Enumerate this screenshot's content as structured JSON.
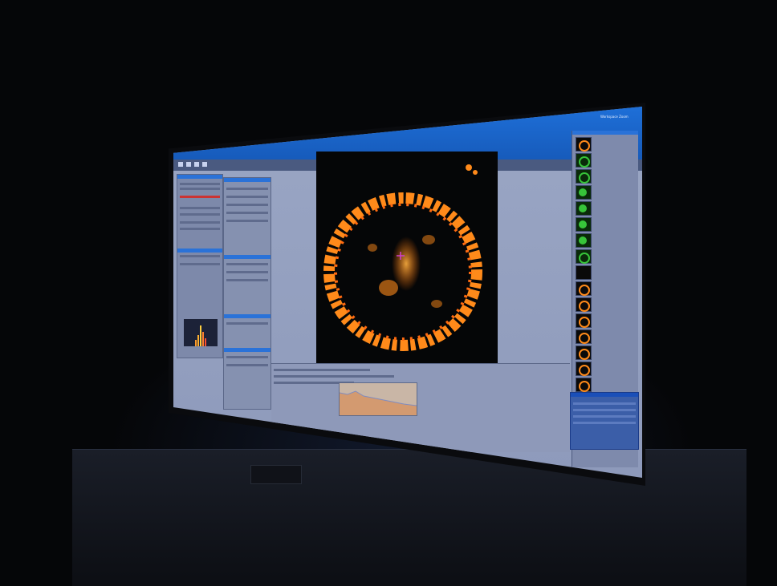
{
  "scene": {
    "description_free": "",
    "colors": {
      "titlebar": "#1e6fd8",
      "panel": "#8591b0",
      "panel_header": "#2a72d8",
      "image_bg": "#050607",
      "signal": "#ff8a1a",
      "green_channel": "#37c43a"
    }
  },
  "window": {
    "title": "Workspace Zoom",
    "icons": [
      "minimize-icon",
      "maximize-icon",
      "close-icon"
    ]
  },
  "left_panel": {
    "histogram": {
      "visible": true
    }
  },
  "image": {
    "channel": "orange"
  },
  "right_panel": {
    "thumbnail_count": 18
  },
  "taskbar": {
    "icons": [
      "start-icon",
      "search-icon",
      "file-explorer-icon",
      "browser-icon"
    ]
  }
}
